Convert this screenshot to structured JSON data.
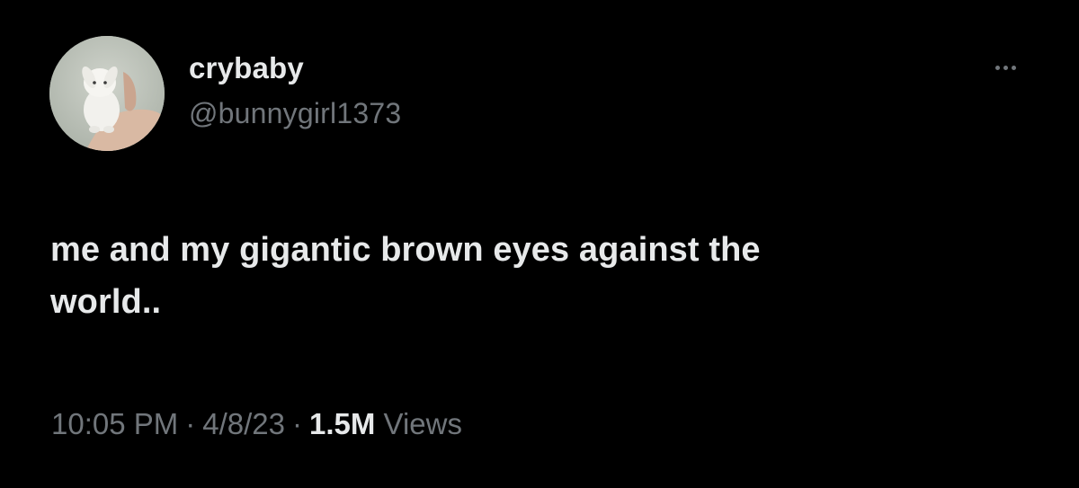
{
  "tweet": {
    "author": {
      "display_name": "crybaby",
      "handle": "@bunnygirl1373",
      "avatar_icon": "bunny-avatar"
    },
    "more_icon": "more-horizontal-icon",
    "text": "me and my gigantic brown eyes against the\nworld..",
    "meta": {
      "time": "10:05 PM",
      "separator": "·",
      "date": "4/8/23",
      "views_count": "1.5M",
      "views_label": "Views"
    }
  },
  "colors": {
    "background": "#000000",
    "primary_text": "#e7e9ea",
    "secondary_text": "#71767b"
  }
}
